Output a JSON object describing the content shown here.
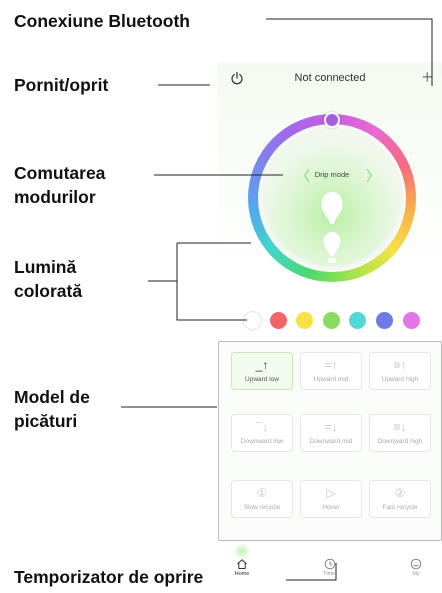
{
  "callouts": {
    "bluetooth": "Conexiune Bluetooth",
    "power": "Pornit/oprit",
    "mode_switch_1": "Comutarea",
    "mode_switch_2": "modurilor",
    "color_light_1": "Lumină",
    "color_light_2": "colorată",
    "drip_model_1": "Model de",
    "drip_model_2": "picături",
    "timer": "Temporizator de oprire"
  },
  "app": {
    "status": "Not connected",
    "mode": "Drip mode",
    "colors": [
      "#ffffff",
      "#f26465",
      "#f7e246",
      "#8bdc5e",
      "#52d9d1",
      "#6b7ce6",
      "#e574e8"
    ],
    "modes": [
      {
        "label": "Upward low",
        "icon": "up-low-icon",
        "glyph": "_↑",
        "active": true
      },
      {
        "label": "Upward mid",
        "icon": "up-mid-icon",
        "glyph": "=↑",
        "active": false
      },
      {
        "label": "Upward high",
        "icon": "up-high-icon",
        "glyph": "≡↑",
        "active": false
      },
      {
        "label": "Downward low",
        "icon": "down-low-icon",
        "glyph": "¯↓",
        "active": false
      },
      {
        "label": "Downward mid",
        "icon": "down-mid-icon",
        "glyph": "=↓",
        "active": false
      },
      {
        "label": "Downward high",
        "icon": "down-high-icon",
        "glyph": "≡↓",
        "active": false
      },
      {
        "label": "Slow recycle",
        "icon": "slow-recycle-icon",
        "glyph": "①",
        "active": false
      },
      {
        "label": "Hover",
        "icon": "hover-icon",
        "glyph": "▷",
        "active": false
      },
      {
        "label": "Fast recycle",
        "icon": "fast-recycle-icon",
        "glyph": "②",
        "active": false
      }
    ],
    "tabs": [
      {
        "label": "Home",
        "icon": "home-icon"
      },
      {
        "label": "Timer",
        "icon": "clock-icon"
      },
      {
        "label": "My",
        "icon": "smile-icon"
      }
    ]
  }
}
